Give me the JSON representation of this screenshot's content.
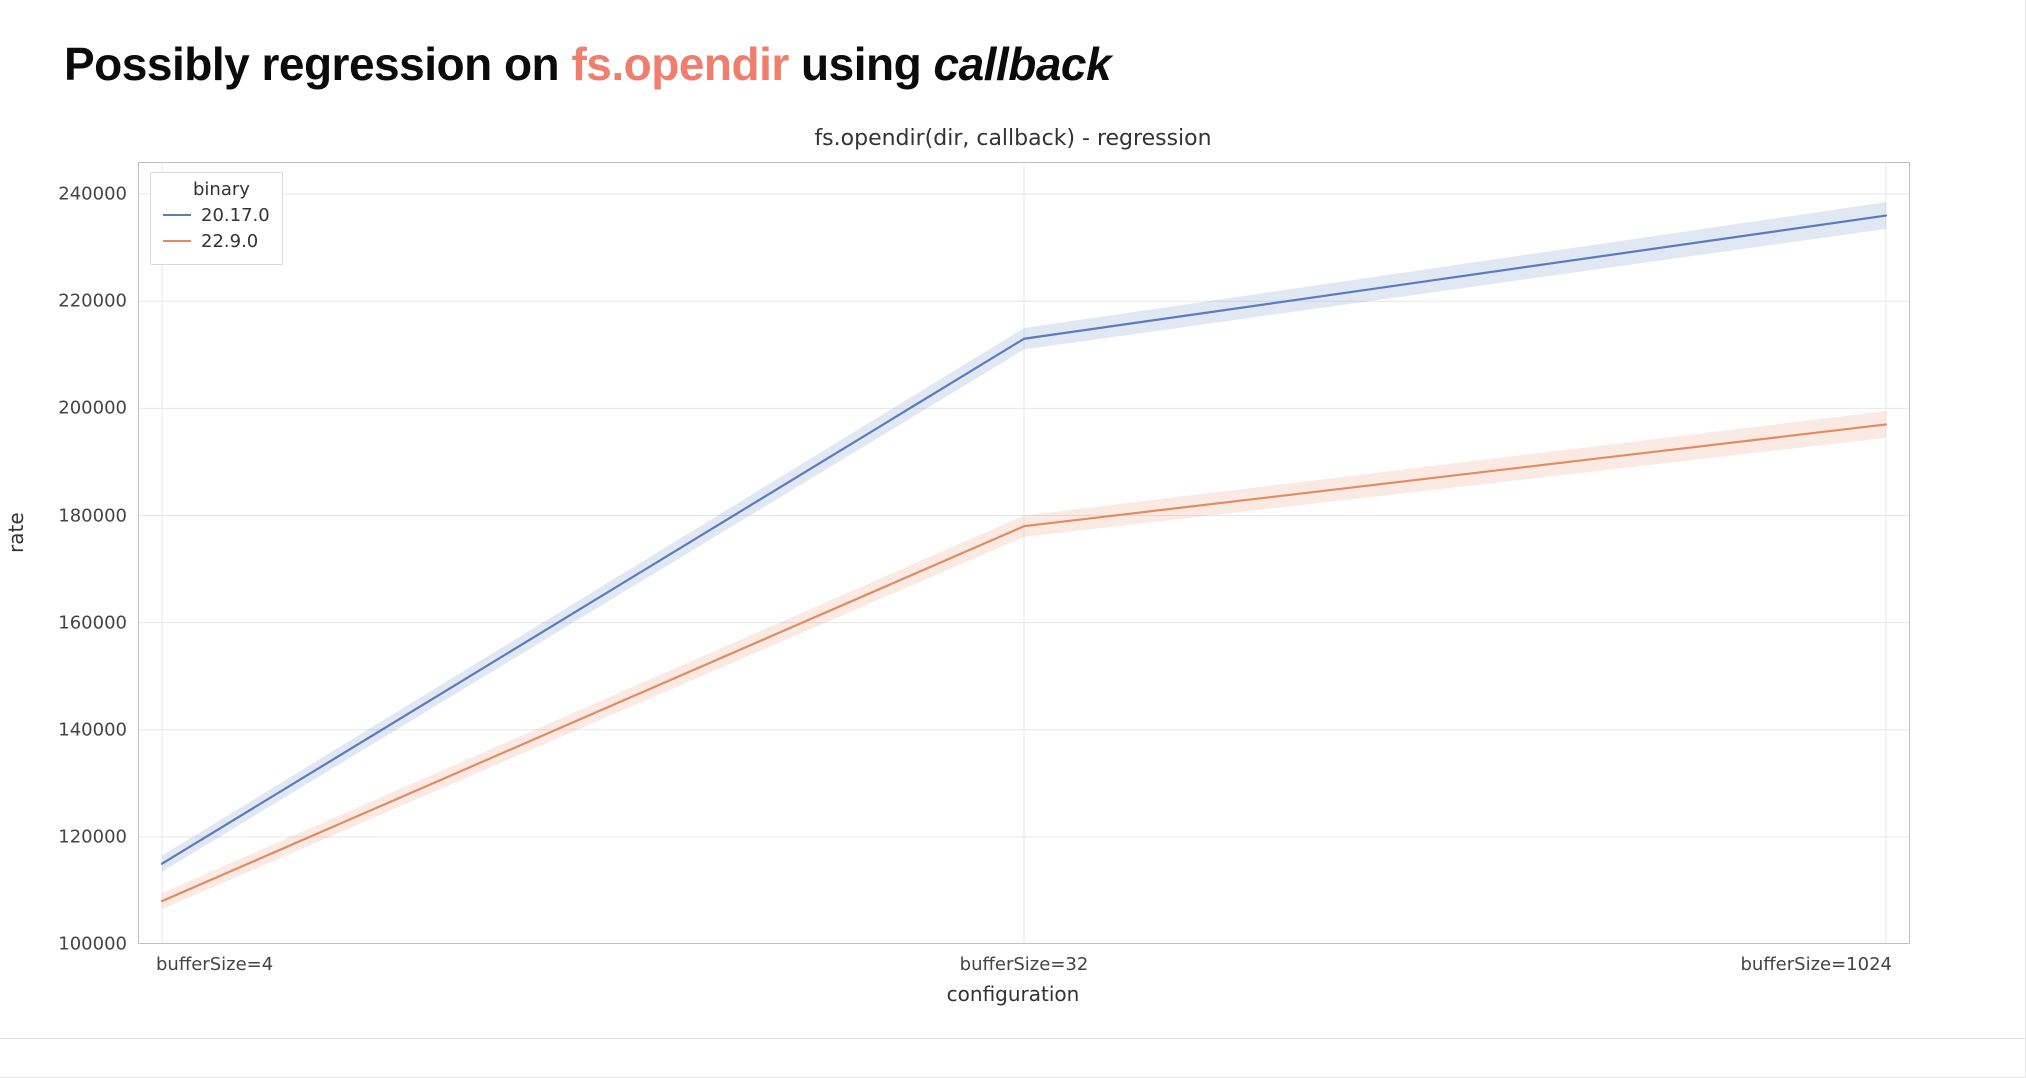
{
  "headline": {
    "prefix": "Possibly regression on ",
    "accent": "fs.opendir",
    "mid": " using ",
    "em": "callback"
  },
  "colors": {
    "series_a": "#5b7bbf",
    "series_b": "#e28b62",
    "series_a_band": "rgba(91,123,191,0.18)",
    "series_b_band": "rgba(226,139,98,0.18)",
    "grid": "#e7e7e7",
    "spine": "#bfbfbf"
  },
  "chart_data": {
    "type": "line",
    "title": "fs.opendir(dir, callback) - regression",
    "xlabel": "configuration",
    "ylabel": "rate",
    "categories": [
      "bufferSize=4",
      "bufferSize=32",
      "bufferSize=1024"
    ],
    "yticks": [
      100000,
      120000,
      140000,
      160000,
      180000,
      200000,
      220000,
      240000
    ],
    "ylim": [
      100000,
      246000
    ],
    "legend_title": "binary",
    "legend_position": "upper left",
    "grid": true,
    "series": [
      {
        "name": "20.17.0",
        "values": [
          115000,
          213000,
          236000
        ],
        "band_low": [
          113500,
          211000,
          233500
        ],
        "band_high": [
          116500,
          215000,
          238500
        ]
      },
      {
        "name": "22.9.0",
        "values": [
          108000,
          178000,
          197000
        ],
        "band_low": [
          106500,
          176000,
          194500
        ],
        "band_high": [
          109500,
          180000,
          199500
        ]
      }
    ]
  }
}
